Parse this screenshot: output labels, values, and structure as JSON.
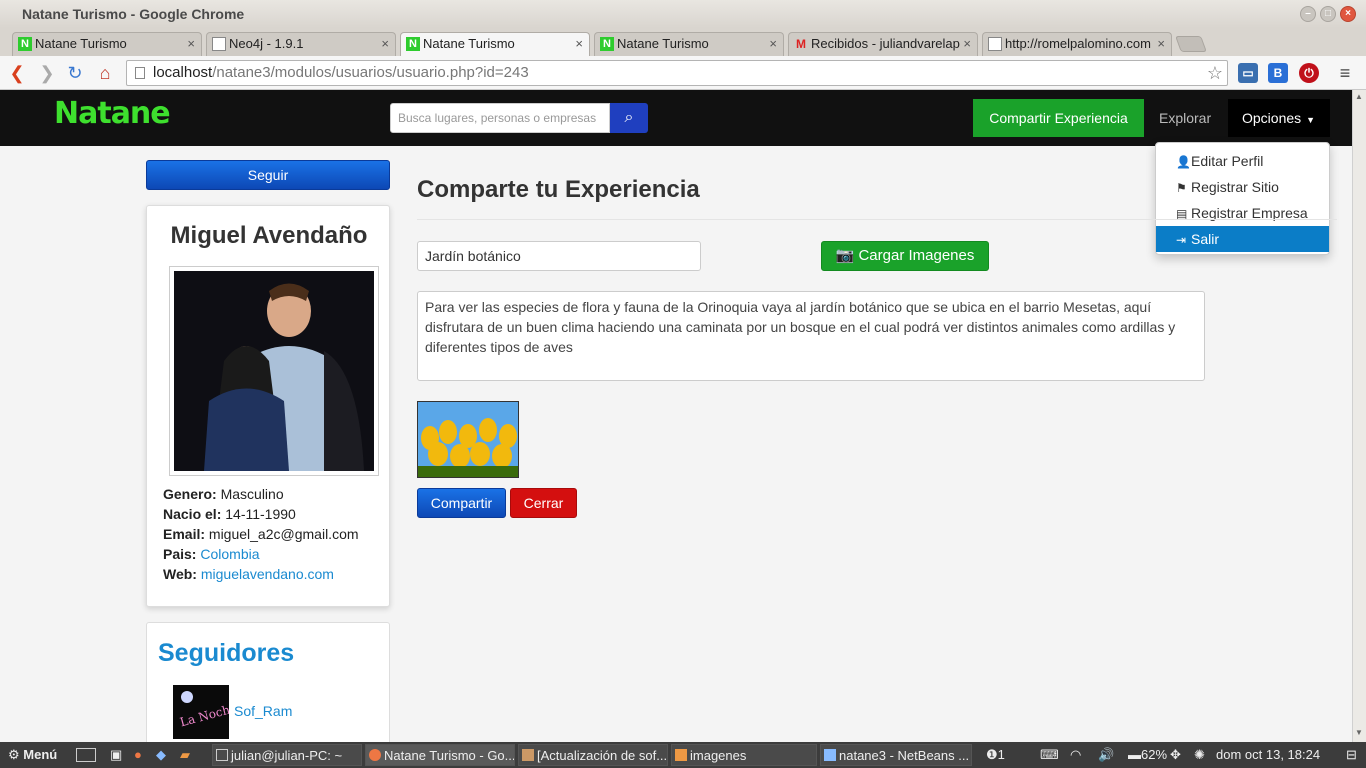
{
  "window": {
    "title": "Natane Turismo - Google Chrome"
  },
  "tabs": [
    {
      "label": "Natane Turismo",
      "icon": "natane-favicon"
    },
    {
      "label": "Neo4j - 1.9.1",
      "icon": "document-icon"
    },
    {
      "label": "Natane Turismo",
      "icon": "natane-favicon"
    },
    {
      "label": "Natane Turismo",
      "icon": "natane-favicon"
    },
    {
      "label": "Recibidos - juliandvarelap",
      "icon": "gmail-icon"
    },
    {
      "label": "http://romelpalomino.com",
      "icon": "document-icon"
    }
  ],
  "address": {
    "host": "localhost",
    "path": "/natane3/modulos/usuarios/usuario.php?id=243"
  },
  "site": {
    "logo": "Natane",
    "search_placeholder": "Busca lugares, personas o empresas",
    "nav": {
      "share": "Compartir Experiencia",
      "explore": "Explorar",
      "options": "Opciones"
    },
    "dropdown": [
      {
        "label": "Editar Perfil",
        "icon": "user-icon"
      },
      {
        "label": "Registrar Sitio",
        "icon": "flag-icon"
      },
      {
        "label": "Registrar Empresa",
        "icon": "building-icon"
      },
      {
        "label": "Salir",
        "icon": "sign-out-icon"
      }
    ]
  },
  "profile": {
    "follow_label": "Seguir",
    "name": "Miguel Avendaño",
    "fields": {
      "gender_label": "Genero:",
      "gender": "Masculino",
      "born_label": "Nacio el:",
      "born": "14-11-1990",
      "email_label": "Email:",
      "email": "miguel_a2c@gmail.com",
      "country_label": "Pais:",
      "country": "Colombia",
      "web_label": "Web:",
      "web": "miguelavendano.com"
    }
  },
  "followers": {
    "title": "Seguidores",
    "items": [
      {
        "name": "Sof_Ram"
      }
    ]
  },
  "experience": {
    "title": "Comparte tu Experiencia",
    "place_value": "Jardín botánico",
    "upload_label": "Cargar Imagenes",
    "description": "Para ver las especies de flora y fauna de la Orinoquia vaya al jardín botánico que se ubica en el barrio Mesetas, aquí disfrutara de un buen clima haciendo una caminata por un bosque en el cual podrá ver distintos animales como ardillas y diferentes tipos de aves",
    "share_label": "Compartir",
    "close_label": "Cerrar"
  },
  "taskbar": {
    "menu": "Menú",
    "tasks": [
      "julian@julian-PC: ~",
      "Natane Turismo - Go...",
      "[Actualización de sof...",
      "imagenes",
      "natane3 - NetBeans ..."
    ],
    "notifications": "1",
    "battery": "62%",
    "clock": "dom oct 13, 18:24"
  },
  "colors": {
    "accent_green": "#1aa22a",
    "accent_blue": "#0d48b5",
    "danger_red": "#d40f0f",
    "link_blue": "#1a8ad0"
  }
}
